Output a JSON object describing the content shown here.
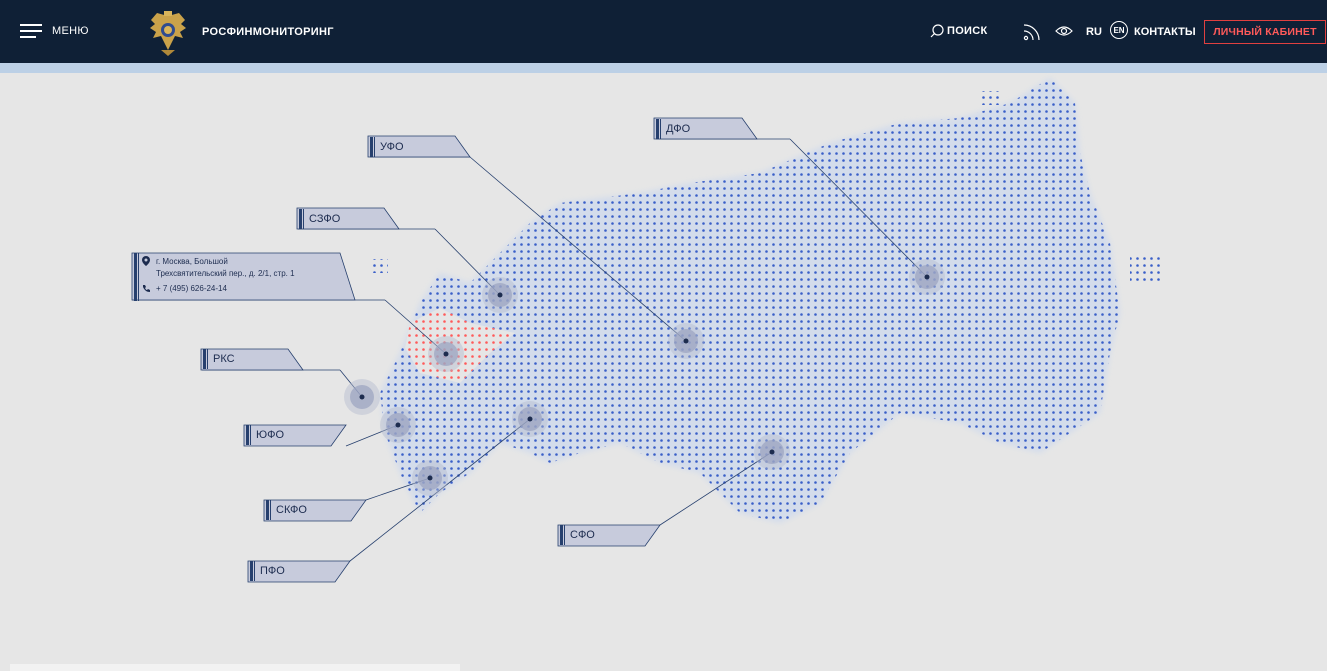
{
  "header": {
    "menu_label": "МЕНЮ",
    "brand": "РОСФИНМОНИТОРИНГ",
    "search_label": "ПОИСК",
    "lang_ru": "RU",
    "lang_en": "EN",
    "contacts_label": "КОНТАКТЫ",
    "cabinet_label": "ЛИЧНЫЙ КАБИНЕТ",
    "colors": {
      "bg": "#0f2036",
      "accent": "#bcd0e6",
      "cabinet": "#e04040"
    }
  },
  "address": {
    "line1": "г. Москва, Большой",
    "line2": "Трехсвятительский пер., д. 2/1, стр. 1",
    "phone": "+ 7 (495) 626-24-14"
  },
  "districts": [
    {
      "id": "ufo",
      "label": "УФО"
    },
    {
      "id": "dfo",
      "label": "ДФО"
    },
    {
      "id": "szfo",
      "label": "СЗФО"
    },
    {
      "id": "rks",
      "label": "РКС"
    },
    {
      "id": "yufo",
      "label": "ЮФО"
    },
    {
      "id": "skfo",
      "label": "СКФО"
    },
    {
      "id": "pfo",
      "label": "ПФО"
    },
    {
      "id": "sfo",
      "label": "СФО"
    }
  ],
  "map_colors": {
    "dots": "#3a5fc8",
    "highlight": "#ff5a5a",
    "tag_fill": "#c7cbdc",
    "line": "#27406e"
  }
}
